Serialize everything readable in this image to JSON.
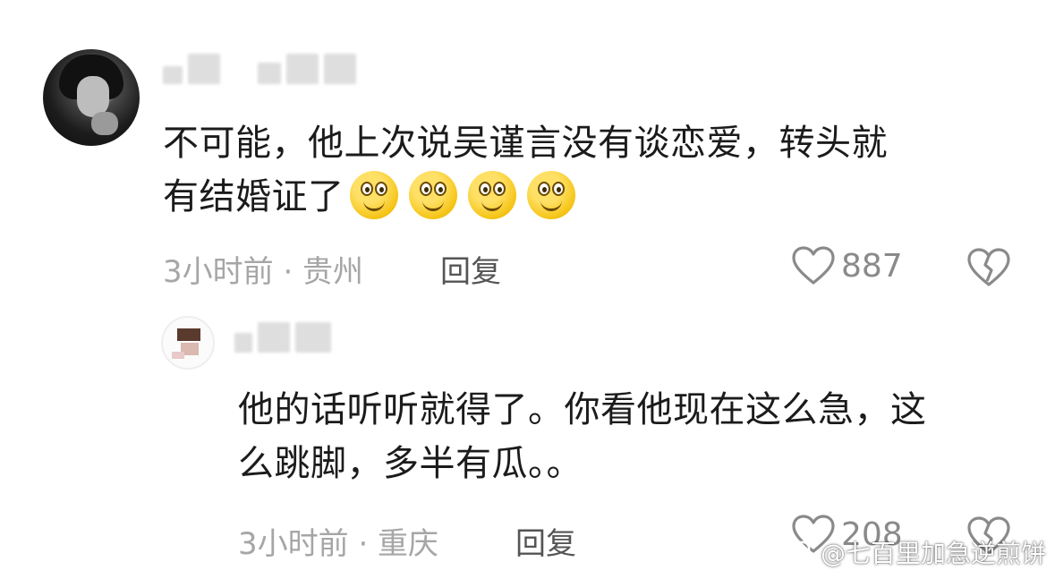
{
  "comments": [
    {
      "text_line1": "不可能，他上次说吴谨言没有谈恋爱，转头就",
      "text_line2": "有结婚证了",
      "emoji_icons": [
        "grin-emoji",
        "grin-emoji",
        "grin-emoji",
        "grin-emoji"
      ],
      "meta": "3小时前 · 贵州",
      "reply_label": "回复",
      "likes": "887"
    },
    {
      "text_line1": "他的话听听就得了。你看他现在这么急，这",
      "text_line2": "么跳脚，多半有瓜。。",
      "meta": "3小时前 · 重庆",
      "reply_label": "回复",
      "likes": "208"
    }
  ],
  "watermark": "@七百里加急逆煎饼",
  "colors": {
    "text": "#1b1b1b",
    "meta": "#a6a6a6",
    "icon": "#8a8a8a",
    "reply": "#555555"
  }
}
